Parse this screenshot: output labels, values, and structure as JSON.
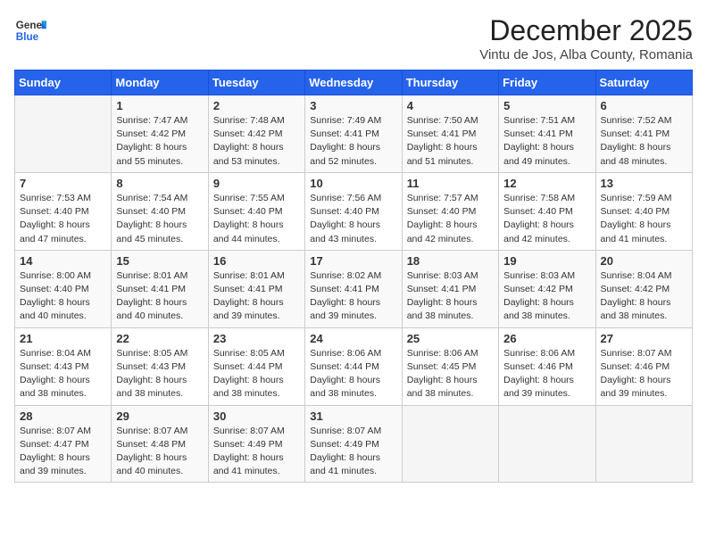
{
  "header": {
    "logo": {
      "general": "General",
      "blue": "Blue"
    },
    "title": "December 2025",
    "location": "Vintu de Jos, Alba County, Romania"
  },
  "weekdays": [
    "Sunday",
    "Monday",
    "Tuesday",
    "Wednesday",
    "Thursday",
    "Friday",
    "Saturday"
  ],
  "weeks": [
    [
      {
        "day": "",
        "info": ""
      },
      {
        "day": "1",
        "info": "Sunrise: 7:47 AM\nSunset: 4:42 PM\nDaylight: 8 hours\nand 55 minutes."
      },
      {
        "day": "2",
        "info": "Sunrise: 7:48 AM\nSunset: 4:42 PM\nDaylight: 8 hours\nand 53 minutes."
      },
      {
        "day": "3",
        "info": "Sunrise: 7:49 AM\nSunset: 4:41 PM\nDaylight: 8 hours\nand 52 minutes."
      },
      {
        "day": "4",
        "info": "Sunrise: 7:50 AM\nSunset: 4:41 PM\nDaylight: 8 hours\nand 51 minutes."
      },
      {
        "day": "5",
        "info": "Sunrise: 7:51 AM\nSunset: 4:41 PM\nDaylight: 8 hours\nand 49 minutes."
      },
      {
        "day": "6",
        "info": "Sunrise: 7:52 AM\nSunset: 4:41 PM\nDaylight: 8 hours\nand 48 minutes."
      }
    ],
    [
      {
        "day": "7",
        "info": "Sunrise: 7:53 AM\nSunset: 4:40 PM\nDaylight: 8 hours\nand 47 minutes."
      },
      {
        "day": "8",
        "info": "Sunrise: 7:54 AM\nSunset: 4:40 PM\nDaylight: 8 hours\nand 45 minutes."
      },
      {
        "day": "9",
        "info": "Sunrise: 7:55 AM\nSunset: 4:40 PM\nDaylight: 8 hours\nand 44 minutes."
      },
      {
        "day": "10",
        "info": "Sunrise: 7:56 AM\nSunset: 4:40 PM\nDaylight: 8 hours\nand 43 minutes."
      },
      {
        "day": "11",
        "info": "Sunrise: 7:57 AM\nSunset: 4:40 PM\nDaylight: 8 hours\nand 42 minutes."
      },
      {
        "day": "12",
        "info": "Sunrise: 7:58 AM\nSunset: 4:40 PM\nDaylight: 8 hours\nand 42 minutes."
      },
      {
        "day": "13",
        "info": "Sunrise: 7:59 AM\nSunset: 4:40 PM\nDaylight: 8 hours\nand 41 minutes."
      }
    ],
    [
      {
        "day": "14",
        "info": "Sunrise: 8:00 AM\nSunset: 4:40 PM\nDaylight: 8 hours\nand 40 minutes."
      },
      {
        "day": "15",
        "info": "Sunrise: 8:01 AM\nSunset: 4:41 PM\nDaylight: 8 hours\nand 40 minutes."
      },
      {
        "day": "16",
        "info": "Sunrise: 8:01 AM\nSunset: 4:41 PM\nDaylight: 8 hours\nand 39 minutes."
      },
      {
        "day": "17",
        "info": "Sunrise: 8:02 AM\nSunset: 4:41 PM\nDaylight: 8 hours\nand 39 minutes."
      },
      {
        "day": "18",
        "info": "Sunrise: 8:03 AM\nSunset: 4:41 PM\nDaylight: 8 hours\nand 38 minutes."
      },
      {
        "day": "19",
        "info": "Sunrise: 8:03 AM\nSunset: 4:42 PM\nDaylight: 8 hours\nand 38 minutes."
      },
      {
        "day": "20",
        "info": "Sunrise: 8:04 AM\nSunset: 4:42 PM\nDaylight: 8 hours\nand 38 minutes."
      }
    ],
    [
      {
        "day": "21",
        "info": "Sunrise: 8:04 AM\nSunset: 4:43 PM\nDaylight: 8 hours\nand 38 minutes."
      },
      {
        "day": "22",
        "info": "Sunrise: 8:05 AM\nSunset: 4:43 PM\nDaylight: 8 hours\nand 38 minutes."
      },
      {
        "day": "23",
        "info": "Sunrise: 8:05 AM\nSunset: 4:44 PM\nDaylight: 8 hours\nand 38 minutes."
      },
      {
        "day": "24",
        "info": "Sunrise: 8:06 AM\nSunset: 4:44 PM\nDaylight: 8 hours\nand 38 minutes."
      },
      {
        "day": "25",
        "info": "Sunrise: 8:06 AM\nSunset: 4:45 PM\nDaylight: 8 hours\nand 38 minutes."
      },
      {
        "day": "26",
        "info": "Sunrise: 8:06 AM\nSunset: 4:46 PM\nDaylight: 8 hours\nand 39 minutes."
      },
      {
        "day": "27",
        "info": "Sunrise: 8:07 AM\nSunset: 4:46 PM\nDaylight: 8 hours\nand 39 minutes."
      }
    ],
    [
      {
        "day": "28",
        "info": "Sunrise: 8:07 AM\nSunset: 4:47 PM\nDaylight: 8 hours\nand 39 minutes."
      },
      {
        "day": "29",
        "info": "Sunrise: 8:07 AM\nSunset: 4:48 PM\nDaylight: 8 hours\nand 40 minutes."
      },
      {
        "day": "30",
        "info": "Sunrise: 8:07 AM\nSunset: 4:49 PM\nDaylight: 8 hours\nand 41 minutes."
      },
      {
        "day": "31",
        "info": "Sunrise: 8:07 AM\nSunset: 4:49 PM\nDaylight: 8 hours\nand 41 minutes."
      },
      {
        "day": "",
        "info": ""
      },
      {
        "day": "",
        "info": ""
      },
      {
        "day": "",
        "info": ""
      }
    ]
  ]
}
